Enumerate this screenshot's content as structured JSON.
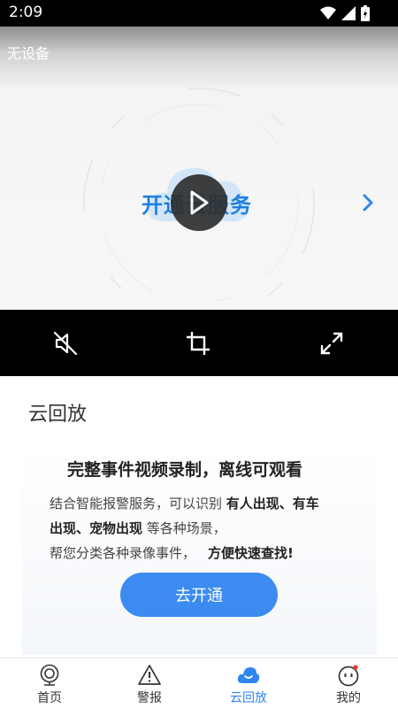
{
  "status_bar": {
    "time": "2:09"
  },
  "player": {
    "device_title": "无设备",
    "promo_text": "开通云服务"
  },
  "section": {
    "title": "云回放",
    "headline": "完整事件视频录制，离线可观看",
    "line1_plain": "结合智能报警服务，可以识别 ",
    "line1_bold": "有人出现、有车",
    "line2_bold": "出现、宠物出现",
    "line2_plain": " 等各种场景，",
    "line3_plain": "帮您分类各种录像事件，",
    "line3_bold": "方便快速查找!",
    "cta_label": "去开通"
  },
  "bottom_nav": {
    "items": [
      {
        "label": "首页",
        "icon": "camera-icon"
      },
      {
        "label": "警报",
        "icon": "warning-icon"
      },
      {
        "label": "云回放",
        "icon": "cloud-icon",
        "active": true
      },
      {
        "label": "我的",
        "icon": "face-icon"
      }
    ],
    "active_color": "#2f86f0"
  },
  "colors": {
    "accent": "#3b8bf0",
    "promo_text": "#1f7ee0",
    "notification_dot": "#e53935"
  }
}
